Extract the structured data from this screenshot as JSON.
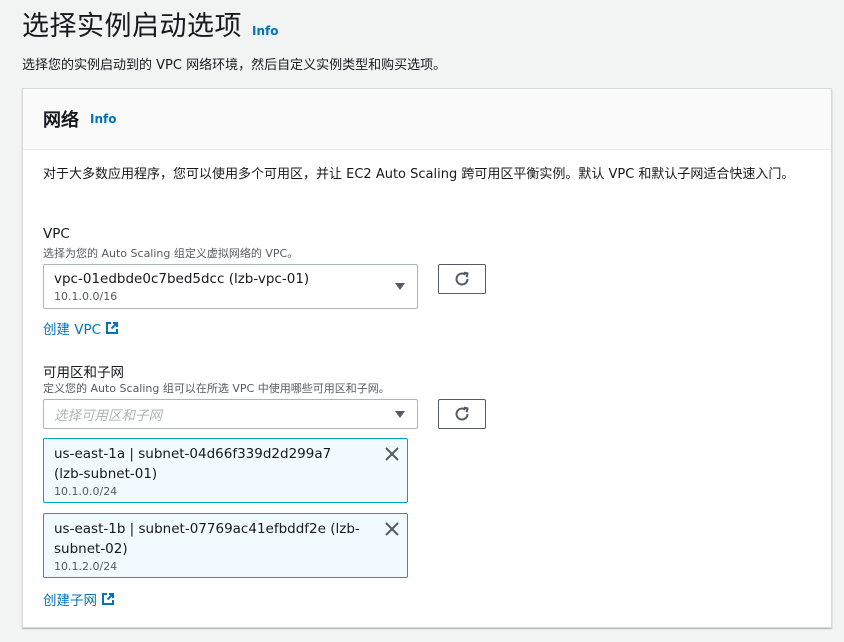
{
  "page": {
    "title": "选择实例启动选项",
    "info": "Info",
    "description": "选择您的实例启动到的 VPC 网络环境，然后自定义实例类型和购买选项。"
  },
  "network": {
    "title": "网络",
    "info": "Info",
    "intro": "对于大多数应用程序，您可以使用多个可用区，并让 EC2 Auto Scaling 跨可用区平衡实例。默认 VPC 和默认子网适合快速入门。",
    "vpc": {
      "label": "VPC",
      "description": "选择为您的 Auto Scaling 组定义虚拟网络的 VPC。",
      "selected": "vpc-01edbde0c7bed5dcc (lzb-vpc-01)",
      "cidr": "10.1.0.0/16",
      "create_link": "创建 VPC"
    },
    "subnets": {
      "label": "可用区和子网",
      "description": "定义您的 Auto Scaling 组可以在所选 VPC 中使用哪些可用区和子网。",
      "placeholder": "选择可用区和子网",
      "selected": [
        {
          "name": "us-east-1a | subnet-04d66f339d2d299a7 (lzb-subnet-01)",
          "cidr": "10.1.0.0/24"
        },
        {
          "name": "us-east-1b | subnet-07769ac41efbddf2e (lzb-subnet-02)",
          "cidr": "10.1.2.0/24"
        }
      ],
      "create_link": "创建子网"
    }
  },
  "icons": {
    "refresh": "refresh-icon",
    "external": "external-link-icon",
    "dismiss": "close-icon",
    "dropdown": "caret-down-icon"
  },
  "colors": {
    "link": "#0073bb",
    "token_bg": "#f1faff",
    "token_border": "#00a1c9"
  }
}
